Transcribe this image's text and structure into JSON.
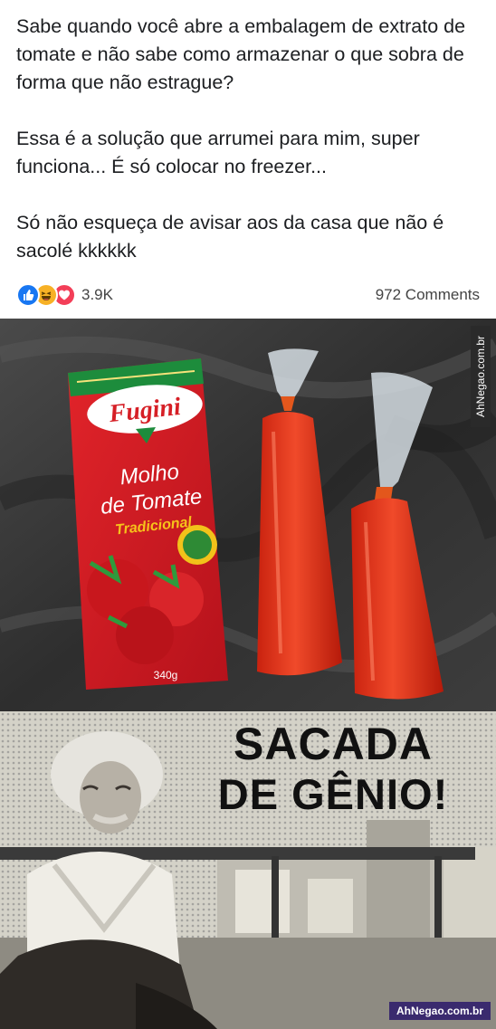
{
  "post": {
    "paragraphs": [
      "Sabe quando você abre a embalagem de extrato de tomate e não sabe como armazenar o que sobra de forma que não estrague?",
      "Essa é a solução que arrumei para mim, super funciona... É só colocar no freezer...",
      "Só não esqueça de avisar aos da casa que não é sacolé kkkkkk"
    ]
  },
  "reactions": {
    "icons": [
      "like-icon",
      "haha-icon",
      "love-icon"
    ],
    "count": "3.9K",
    "comments": "972 Comments",
    "colors": {
      "like": "#1877f2",
      "haha": "#f7b125",
      "love": "#f33e58"
    }
  },
  "photo": {
    "package": {
      "brand": "Fugini",
      "product": "Molho de Tomate",
      "variant": "Tradicional",
      "weight": "340g"
    },
    "watermark": "AhNegao.com.br"
  },
  "meme": {
    "title_line1": "SACADA",
    "title_line2": "DE GÊNIO!",
    "watermark": "AhNegao.com.br"
  }
}
